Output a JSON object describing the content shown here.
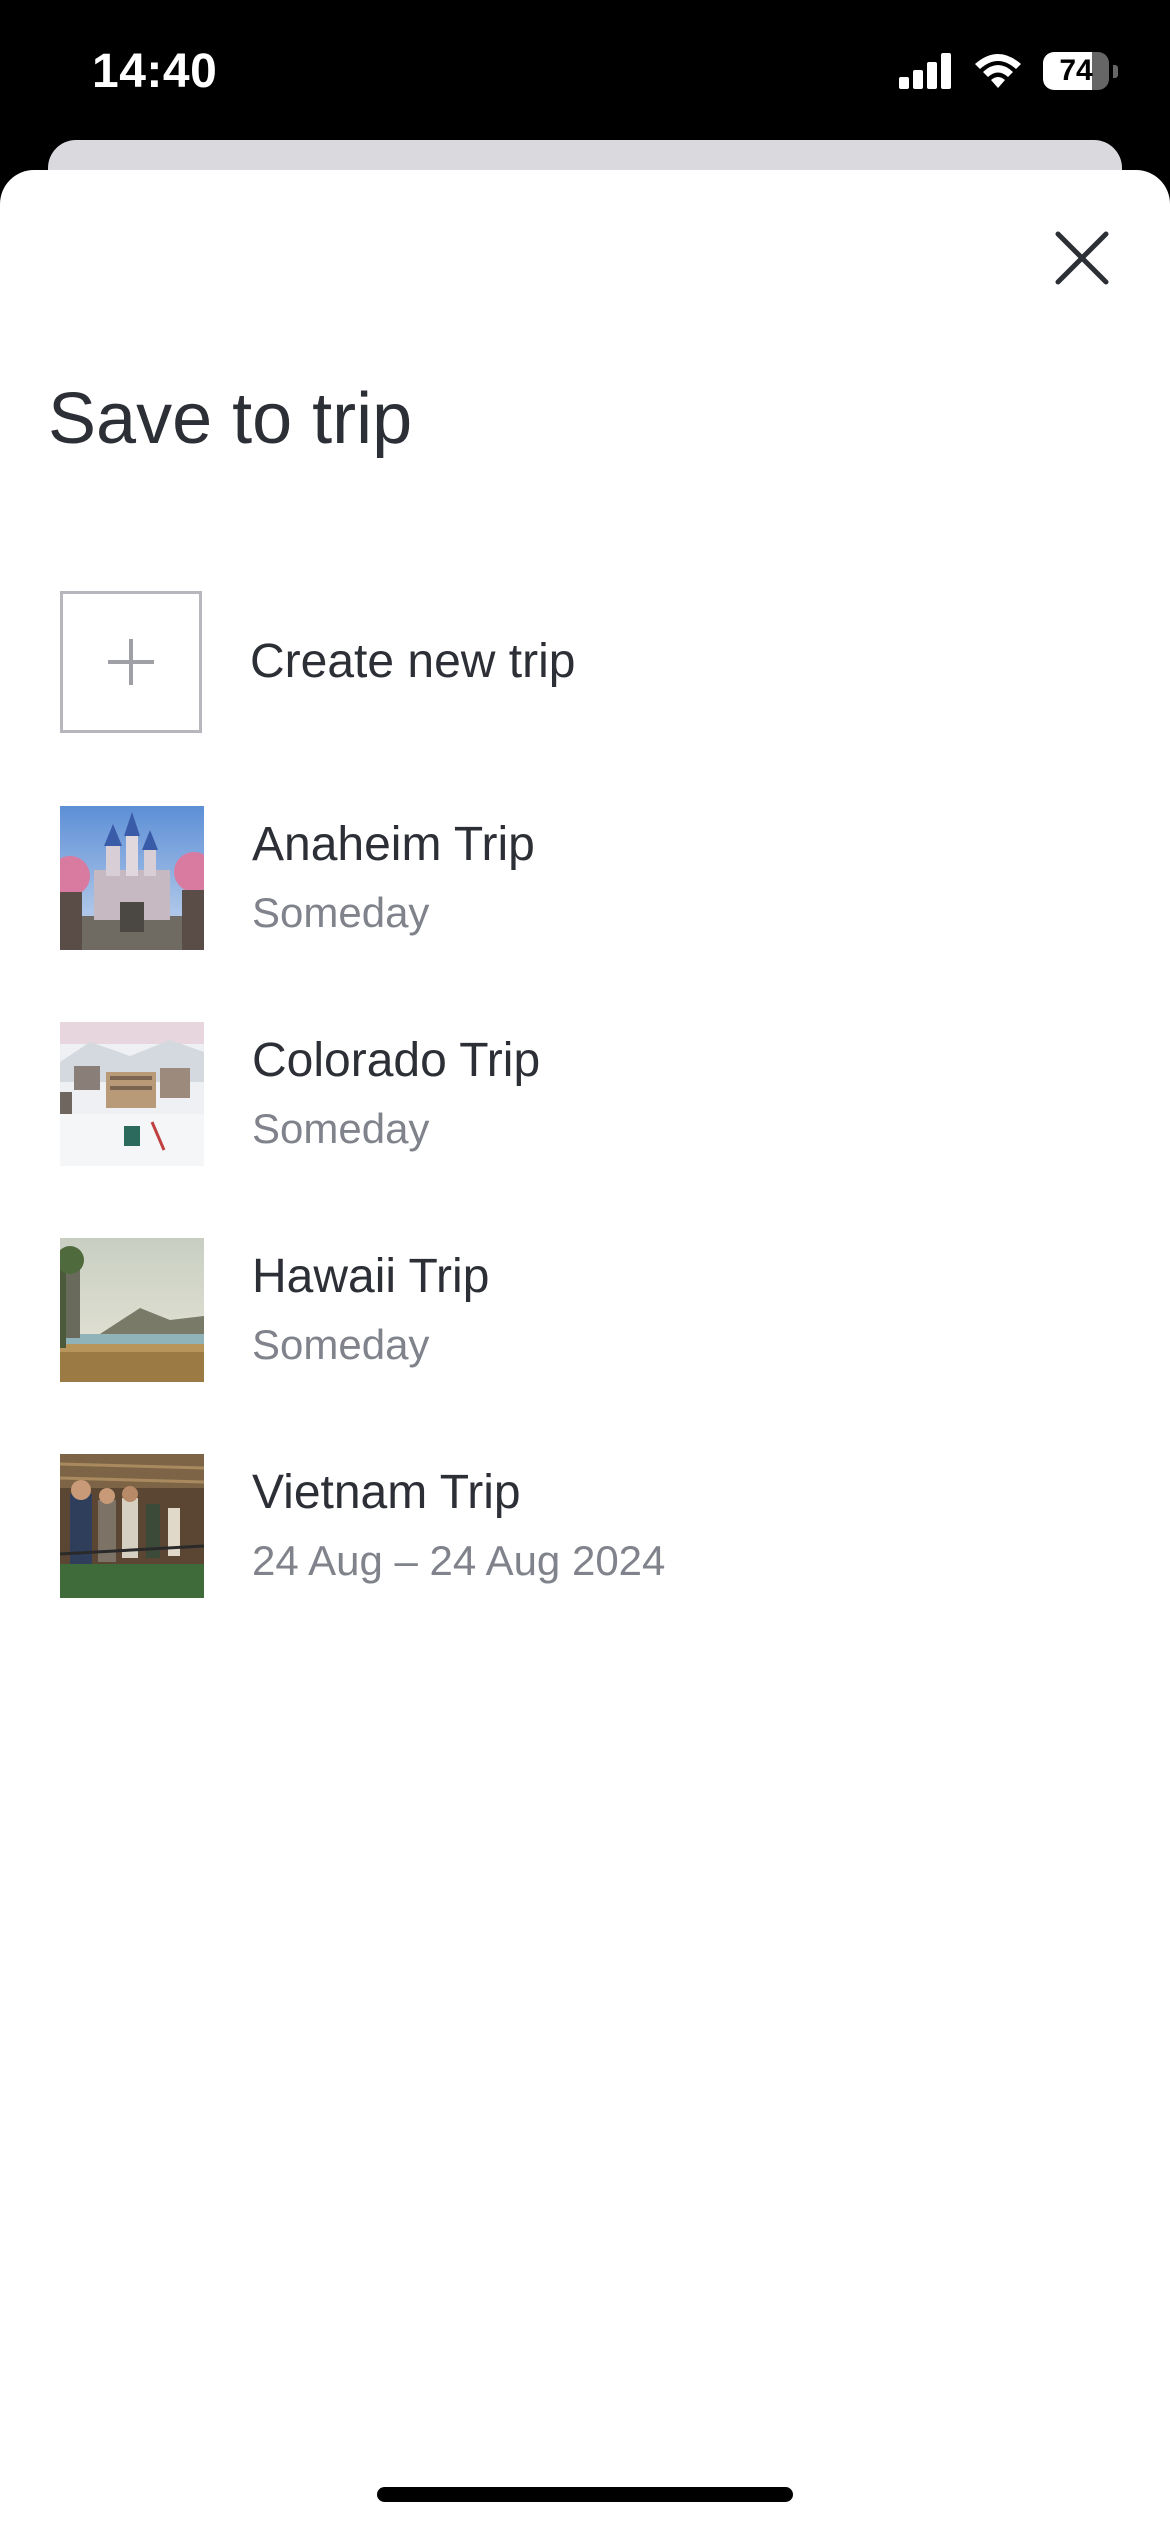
{
  "status_bar": {
    "time": "14:40",
    "battery_level": "74",
    "icons": [
      "signal-icon",
      "wifi-icon",
      "battery-icon"
    ]
  },
  "sheet": {
    "title": "Save to trip",
    "close_icon": "close-icon",
    "create_new_label": "Create new trip",
    "create_icon": "plus-icon"
  },
  "trips": [
    {
      "name": "Anaheim Trip",
      "subtitle": "Someday",
      "image": "castle-photo"
    },
    {
      "name": "Colorado Trip",
      "subtitle": "Someday",
      "image": "snowy-town-photo"
    },
    {
      "name": "Hawaii Trip",
      "subtitle": "Someday",
      "image": "beach-photo"
    },
    {
      "name": "Vietnam Trip",
      "subtitle": "24 Aug – 24 Aug 2024",
      "image": "market-photo"
    }
  ],
  "colors": {
    "title_text": "#2d2f36",
    "subtitle_text": "#80838b",
    "border": "#b5b7bd"
  }
}
